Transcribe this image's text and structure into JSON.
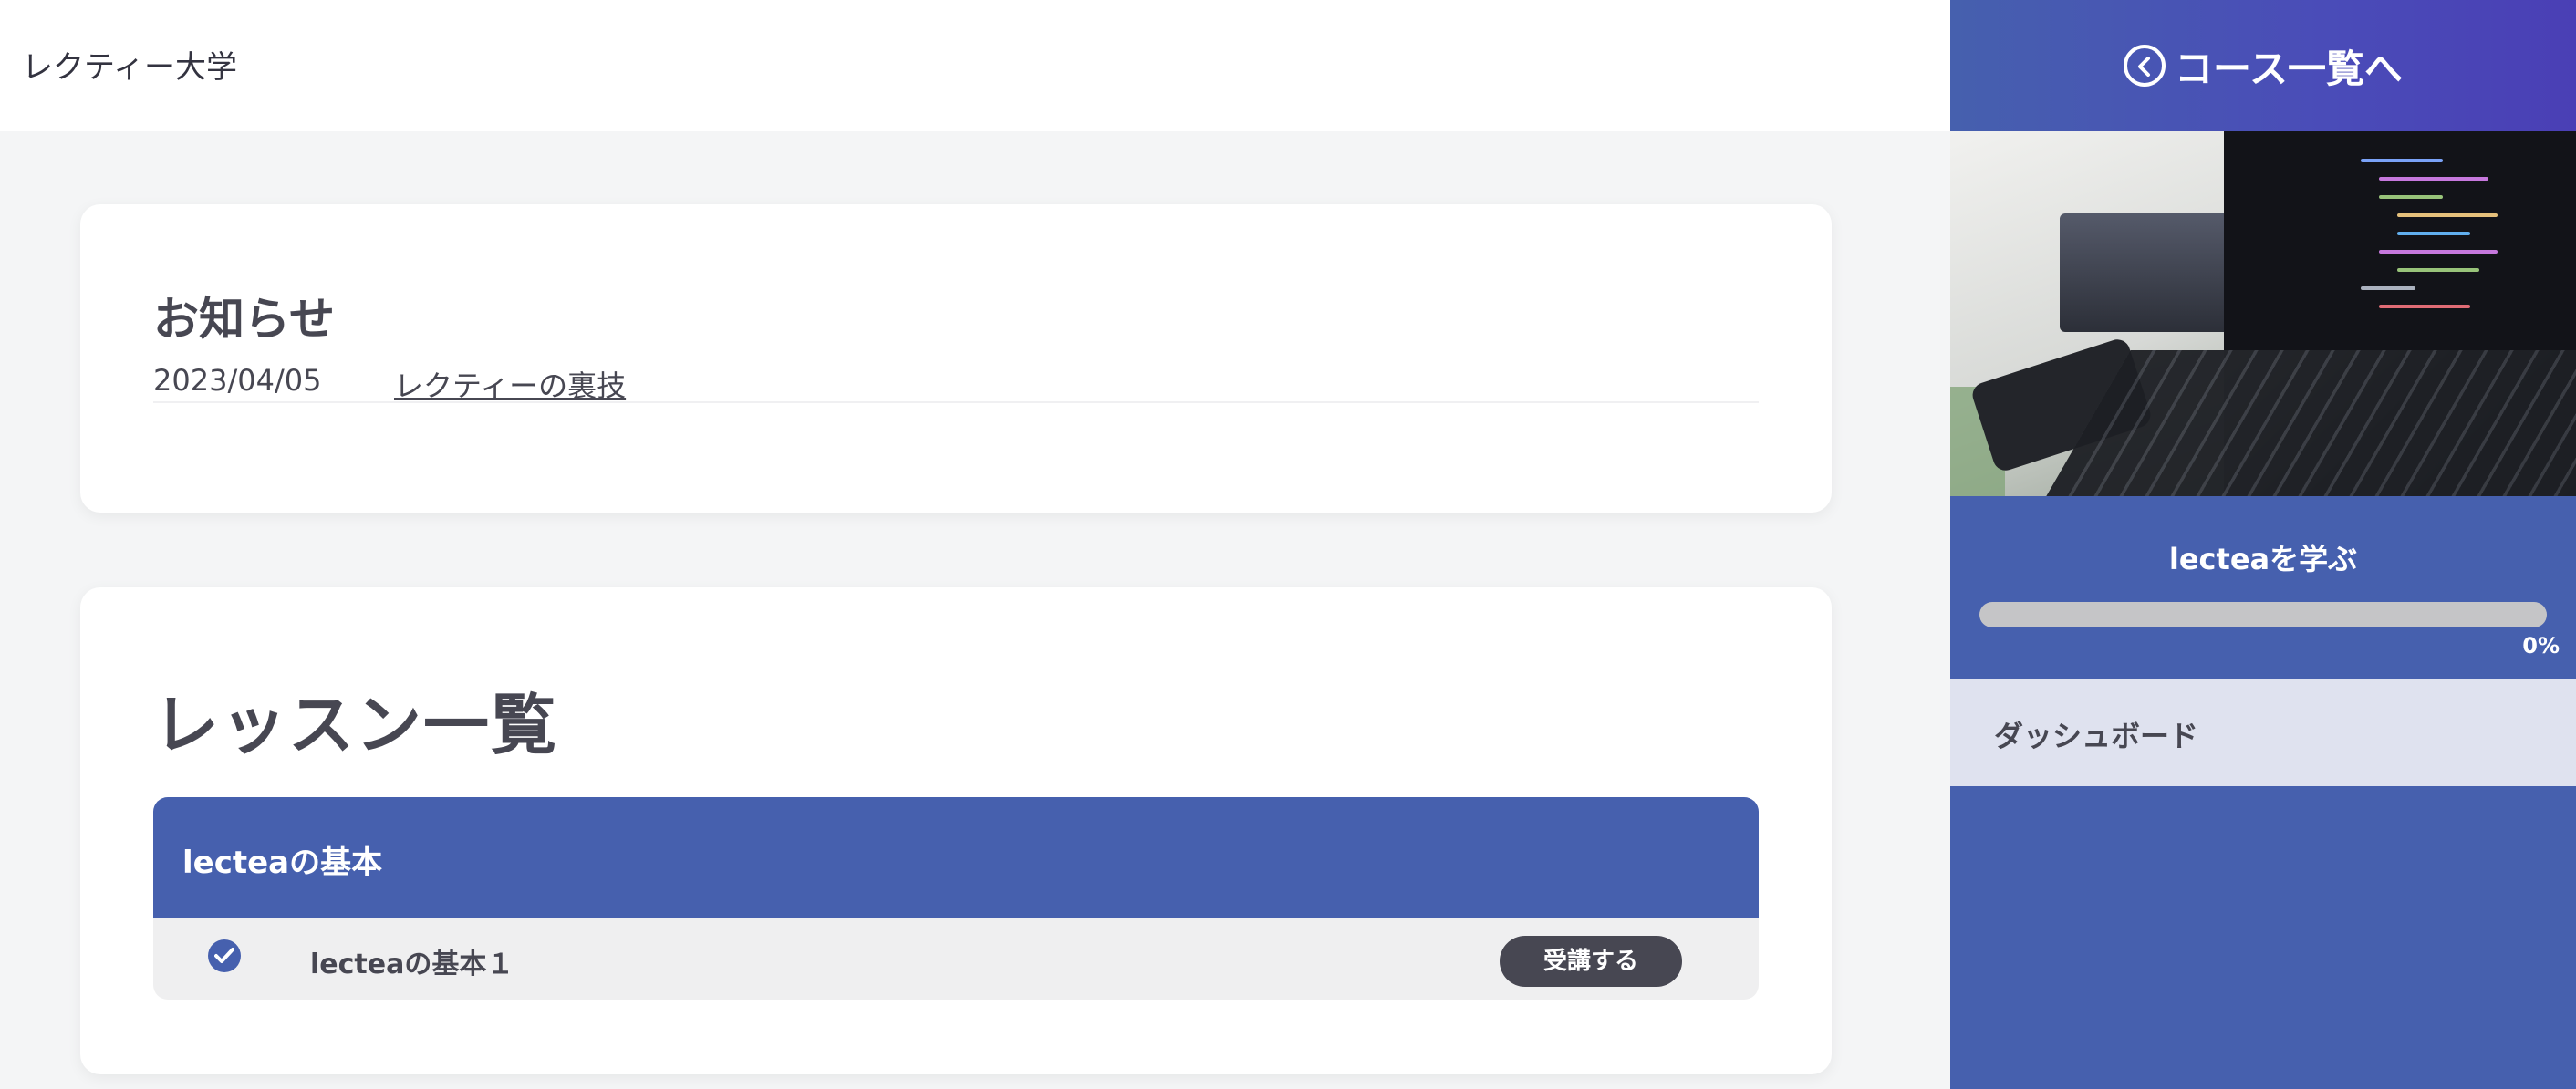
{
  "header": {
    "brand": "レクティー大学"
  },
  "news": {
    "title": "お知らせ",
    "items": [
      {
        "date": "2023/04/05",
        "title": "レクティーの裏技"
      }
    ]
  },
  "lessons": {
    "title": "レッスン一覧",
    "sections": [
      {
        "title": "lecteaの基本",
        "items": [
          {
            "title": "lecteaの基本１",
            "completed": true,
            "button_label": "受講する"
          }
        ]
      }
    ]
  },
  "sidebar": {
    "back_label": "コース一覧へ",
    "course_name": "lecteaを学ぶ",
    "progress_percent": 0,
    "progress_label": "0%",
    "nav_items": [
      {
        "label": "ダッシュボード"
      }
    ]
  },
  "colors": {
    "primary": "#4660ae",
    "text": "#474752",
    "button": "#474752",
    "nav_active_bg": "#dfe2ef"
  },
  "icons": {
    "back": "chevron-left-circle-icon",
    "check": "check-circle-icon",
    "hero": "laptop-photo"
  }
}
